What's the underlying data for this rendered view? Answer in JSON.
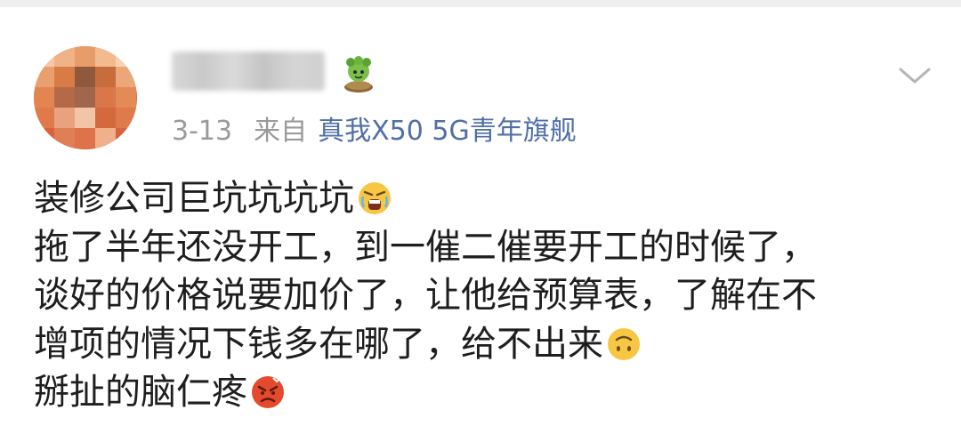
{
  "post": {
    "date": "3-13",
    "from_label": "来自",
    "device": "真我X50 5G青年旗舰",
    "lines": [
      "装修公司巨坑坑坑坑",
      "拖了半年还没开工，到一催二催要开工的时候了，",
      "谈好的价格说要加价了，让他给预算表，了解在不",
      "增项的情况下钱多在哪了，给不出来",
      "掰扯的脑仁疼"
    ]
  },
  "icons": {
    "avatar": "blurred-avatar",
    "badge": "green-cartoon-badge-icon",
    "menu": "chevron-down-icon",
    "emoji_1": "crying-shouting-emoji-icon",
    "emoji_2": "upside-down-face-emoji-icon",
    "emoji_3": "angry-face-emoji-icon"
  },
  "colors": {
    "meta_gray": "#9a9a9a",
    "device_link": "#4f6fa6",
    "text": "#1e1e1e"
  }
}
